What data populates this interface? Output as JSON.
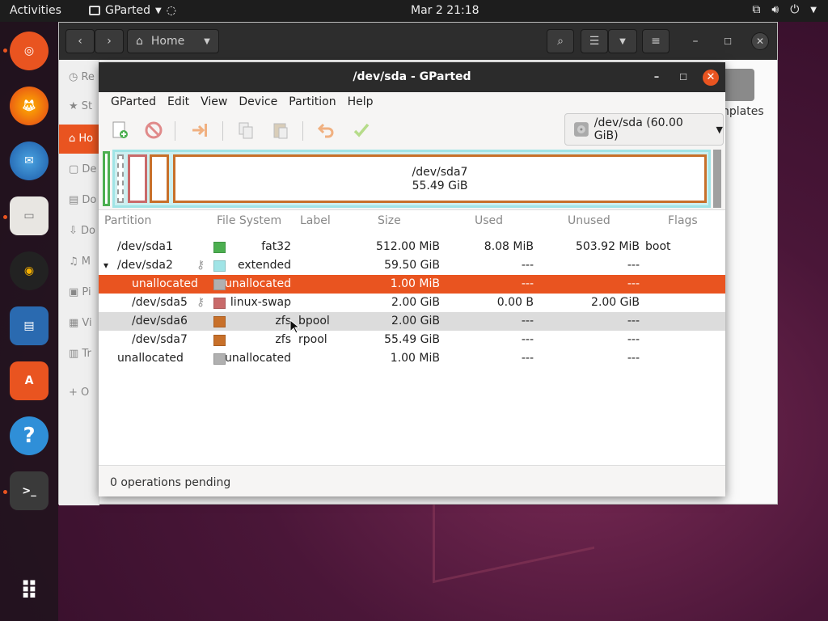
{
  "topbar": {
    "activities": "Activities",
    "app_name": "GParted",
    "clock": "Mar 2  21:18"
  },
  "files_window": {
    "location": "Home",
    "sidebar_labels": [
      "Re",
      "St",
      "Ho",
      "De",
      "Do",
      "Do",
      "M",
      "Pi",
      "Vi",
      "Tr",
      "O"
    ],
    "partial_label": "nplates"
  },
  "gparted": {
    "title": "/dev/sda - GParted",
    "menu": [
      "GParted",
      "Edit",
      "View",
      "Device",
      "Partition",
      "Help"
    ],
    "device_selector": "/dev/sda (60.00 GiB)",
    "diskmap": {
      "label_name": "/dev/sda7",
      "label_size": "55.49 GiB"
    },
    "columns": [
      "Partition",
      "File System",
      "Label",
      "Size",
      "Used",
      "Unused",
      "Flags"
    ],
    "rows": [
      {
        "partition": "/dev/sda1",
        "fs": "fat32",
        "label": "",
        "size": "512.00 MiB",
        "used": "8.08 MiB",
        "unused": "503.92 MiB",
        "flags": "boot",
        "color": "#4caf50",
        "indent": 0,
        "key": false,
        "expander": false,
        "state": ""
      },
      {
        "partition": "/dev/sda2",
        "fs": "extended",
        "label": "",
        "size": "59.50 GiB",
        "used": "---",
        "unused": "---",
        "flags": "",
        "color": "#a0e4e6",
        "indent": 0,
        "key": true,
        "expander": true,
        "state": ""
      },
      {
        "partition": "unallocated",
        "fs": "unallocated",
        "label": "",
        "size": "1.00 MiB",
        "used": "---",
        "unused": "---",
        "flags": "",
        "color": "#b0b0b0",
        "indent": 1,
        "key": false,
        "expander": false,
        "state": "sel"
      },
      {
        "partition": "/dev/sda5",
        "fs": "linux-swap",
        "label": "",
        "size": "2.00 GiB",
        "used": "0.00 B",
        "unused": "2.00 GiB",
        "flags": "",
        "color": "#c96a6a",
        "indent": 1,
        "key": true,
        "expander": false,
        "state": ""
      },
      {
        "partition": "/dev/sda6",
        "fs": "zfs",
        "label": "bpool",
        "size": "2.00 GiB",
        "used": "---",
        "unused": "---",
        "flags": "",
        "color": "#c8702a",
        "indent": 1,
        "key": false,
        "expander": false,
        "state": "hover"
      },
      {
        "partition": "/dev/sda7",
        "fs": "zfs",
        "label": "rpool",
        "size": "55.49 GiB",
        "used": "---",
        "unused": "---",
        "flags": "",
        "color": "#c8702a",
        "indent": 1,
        "key": false,
        "expander": false,
        "state": ""
      },
      {
        "partition": "unallocated",
        "fs": "unallocated",
        "label": "",
        "size": "1.00 MiB",
        "used": "---",
        "unused": "---",
        "flags": "",
        "color": "#b0b0b0",
        "indent": 0,
        "key": false,
        "expander": false,
        "state": ""
      }
    ],
    "status": "0 operations pending"
  },
  "colors": {
    "accent": "#e95420",
    "titlebar": "#2b2b2b",
    "fat32": "#4caf50",
    "extended": "#a0e4e6",
    "linux_swap": "#c96a6a",
    "zfs": "#c8702a",
    "unallocated": "#b0b0b0"
  }
}
